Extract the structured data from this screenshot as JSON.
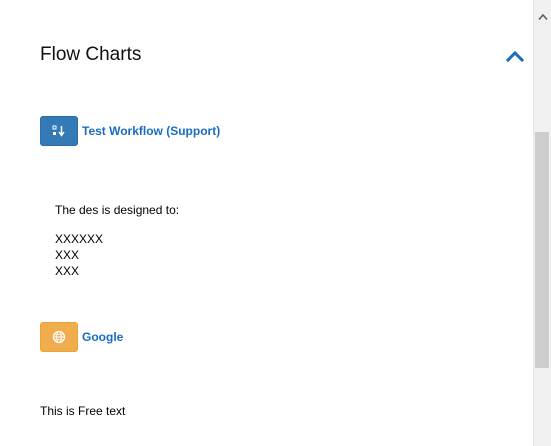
{
  "section": {
    "title": "Flow Charts",
    "collapse_icon": "chevron-up-icon",
    "accent_color": "#1a6cc0"
  },
  "workflow_link": {
    "icon": "sort-down-icon",
    "button_color": "#337ab7",
    "label": "Test Workflow (Support)"
  },
  "description": {
    "intro": "The des is designed to:",
    "lines": [
      "XXXXXX",
      "XXX",
      "XXX"
    ]
  },
  "google_link": {
    "icon": "globe-icon",
    "button_color": "#f0ad4e",
    "label": "Google"
  },
  "free_text": "This is Free text",
  "scrollbar": {
    "up_icon": "scroll-up-arrow-icon"
  }
}
